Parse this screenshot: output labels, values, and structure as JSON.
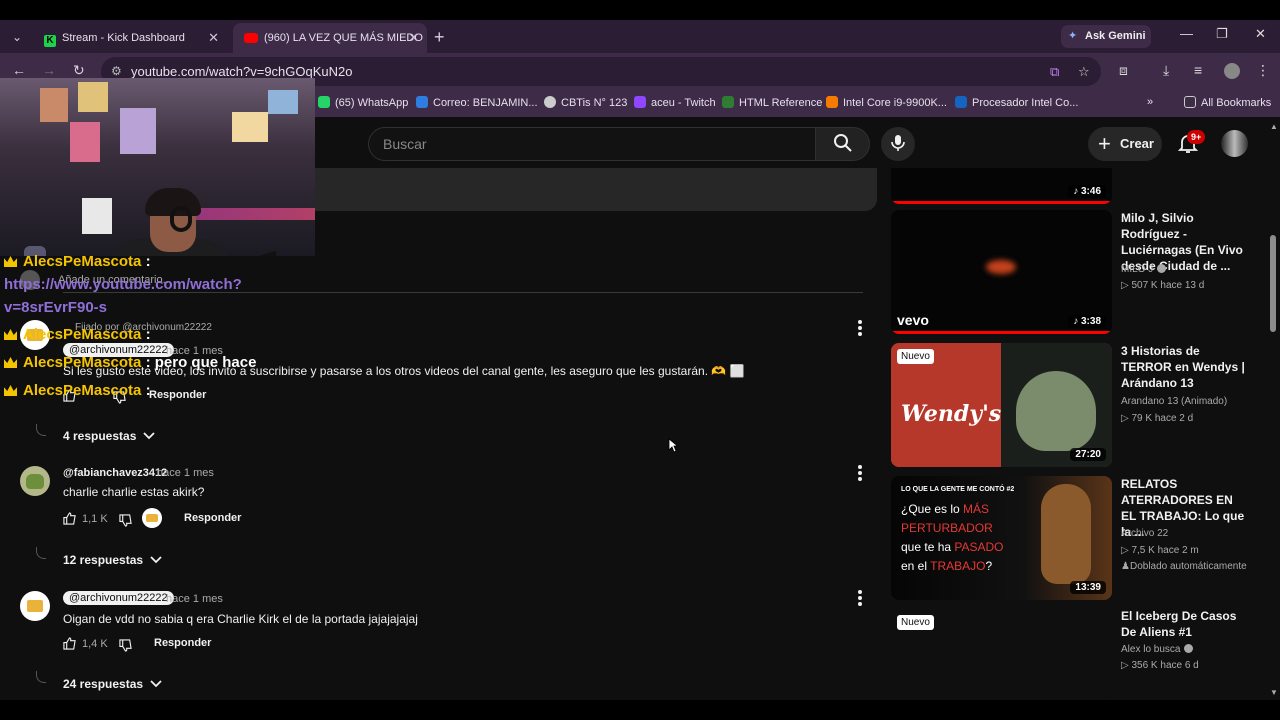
{
  "browser": {
    "tabs": [
      {
        "title": "Stream - Kick Dashboard",
        "favicon": "K"
      },
      {
        "title": "(960) LA VEZ QUE MÁS MIEDO"
      }
    ],
    "ask_gemini": "Ask Gemini",
    "url": "youtube.com/watch?v=9chGOqKuN2o",
    "bookmarks": [
      {
        "label": "(65) WhatsApp",
        "color": "#25d366"
      },
      {
        "label": "Correo: BENJAMIN...",
        "color": "#2f7de1"
      },
      {
        "label": "CBTis N° 123",
        "color": "#cccccc"
      },
      {
        "label": "aceu - Twitch",
        "color": "#9146ff"
      },
      {
        "label": "HTML Reference",
        "color": "#2e7d32"
      },
      {
        "label": "Intel Core i9-9900K...",
        "color": "#f57c00"
      },
      {
        "label": "Procesador Intel Co...",
        "color": "#1565c0"
      }
    ],
    "all_bookmarks": "All Bookmarks"
  },
  "youtube": {
    "search_placeholder": "Buscar",
    "create_label": "Crear",
    "notif_badge": "9+"
  },
  "overlay_chat": {
    "lines": [
      {
        "name": "AlecsPeMascota",
        "sep": " :",
        "msg": ""
      },
      {
        "name": "AlecsPeMascota",
        "sep": " :",
        "msg": ""
      },
      {
        "name": "AlecsPeMascota",
        "sep": " :",
        "msg": " pero que hace"
      },
      {
        "name": "AlecsPeMascota",
        "sep": " :",
        "msg": ""
      }
    ],
    "link_line1": "https://www.youtube.com/watch?",
    "link_line2": "v=8srEvrF90-s"
  },
  "comments": {
    "add_comment_placeholder": "Añade un comentario...",
    "pinned_by": "Fijado por @archivonum22222",
    "items": [
      {
        "handle": "@archivonum22222",
        "time": "hace 1 mes",
        "text": "Si les gusto este video, los invito a suscribirse y pasarse a los otros videos del canal gente, les aseguro que les gustarán. 🫶 ⬜",
        "likes": "",
        "reply_label": "Responder",
        "replies": "4 respuestas"
      },
      {
        "handle": "@fabianchavez3412",
        "time": "hace 1 mes",
        "text": "charlie charlie estas akirk?",
        "likes": "1,1 K",
        "reply_label": "Responder",
        "replies": "12 respuestas"
      },
      {
        "handle": "@archivonum22222",
        "time": "hace 1 mes",
        "text": "Oigan de vdd no sabia q era Charlie Kirk el de la portada jajajajajaj",
        "likes": "1,4 K",
        "reply_label": "Responder",
        "replies": "24 respuestas"
      }
    ]
  },
  "sidebar": {
    "top_duration": "3:46",
    "videos": [
      {
        "title": "Milo J, Silvio Rodríguez - Luciérnagas (En Vivo desde Ciudad de ...",
        "channel": "MILO J",
        "verified": true,
        "meta": "507 K  hace 13 d",
        "duration": "3:38",
        "badge": "vevo",
        "new": false
      },
      {
        "title": "3 Historias de TERROR en Wendys | Arándano 13",
        "channel": "Arandano 13 (Animado)",
        "verified": false,
        "meta": "79 K  hace 2 d",
        "duration": "27:20",
        "badge": "Wendy's",
        "new": true,
        "new_label": "Nuevo"
      },
      {
        "title": "RELATOS ATERRADORES EN EL TRABAJO: Lo que la ...",
        "channel": "Archivo 22",
        "verified": false,
        "meta": "7,5 K  hace 2 m",
        "extra": "Doblado automáticamente",
        "duration": "13:39",
        "new": false,
        "thumb_text": {
          "small": "LO QUE LA GENTE ME CONTÓ #2",
          "l1a": "¿Que es lo ",
          "l1b": "MÁS",
          "l2": "PERTURBADOR",
          "l3a": "que te ha ",
          "l3b": "PASADO",
          "l4a": "en el ",
          "l4b": "TRABAJO",
          "l4c": "?"
        }
      },
      {
        "title": "El Iceberg De Casos De Aliens #1",
        "channel": "Alex lo busca",
        "verified": true,
        "meta": "356 K  hace 6 d",
        "new": true,
        "new_label": "Nuevo"
      }
    ]
  }
}
